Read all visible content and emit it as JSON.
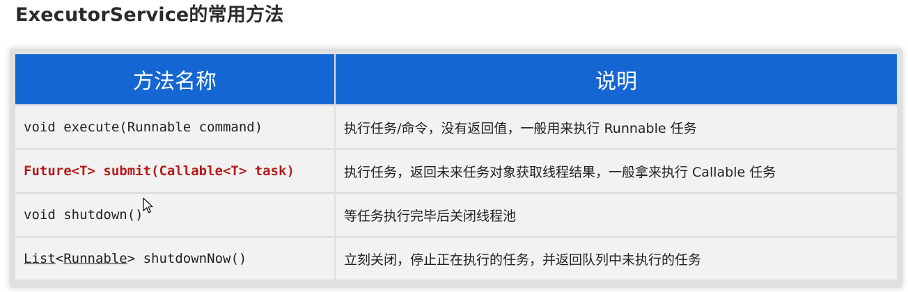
{
  "page": {
    "title": "ExecutorService的常用方法"
  },
  "table": {
    "header_color": "#1467d2",
    "highlight_color": "#b31b1b",
    "columns": [
      "方法名称",
      "说明"
    ],
    "rows": [
      {
        "method": "void execute(Runnable command)",
        "description": "执行任务/命令，没有返回值，一般用来执行 Runnable 任务",
        "highlighted": false
      },
      {
        "method": "Future<T> submit(Callable<T> task)",
        "description": "执行任务，返回未来任务对象获取线程结果，一般拿来执行 Callable 任务",
        "highlighted": true
      },
      {
        "method": "void shutdown()",
        "description": "等任务执行完毕后关闭线程池",
        "highlighted": false
      },
      {
        "method_parts": [
          "List",
          "<",
          "Runnable",
          "> shutdownNow()"
        ],
        "description": "立刻关闭，停止正在执行的任务，并返回队列中未执行的任务",
        "highlighted": false
      }
    ]
  },
  "icons": {
    "cursor": "mouse-pointer-icon"
  }
}
